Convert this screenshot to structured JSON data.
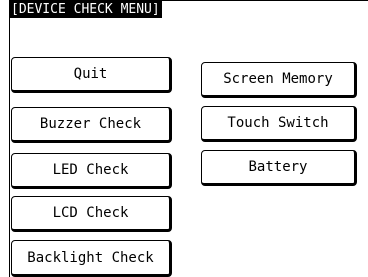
{
  "title": "[DEVICE CHECK MENU]",
  "left_buttons": [
    {
      "label": "Quit"
    },
    {
      "label": "Buzzer Check"
    },
    {
      "label": "LED Check"
    },
    {
      "label": "LCD Check"
    },
    {
      "label": "Backlight Check"
    }
  ],
  "right_buttons": [
    {
      "label": "Screen Memory"
    },
    {
      "label": "Touch Switch"
    },
    {
      "label": "Battery"
    }
  ]
}
